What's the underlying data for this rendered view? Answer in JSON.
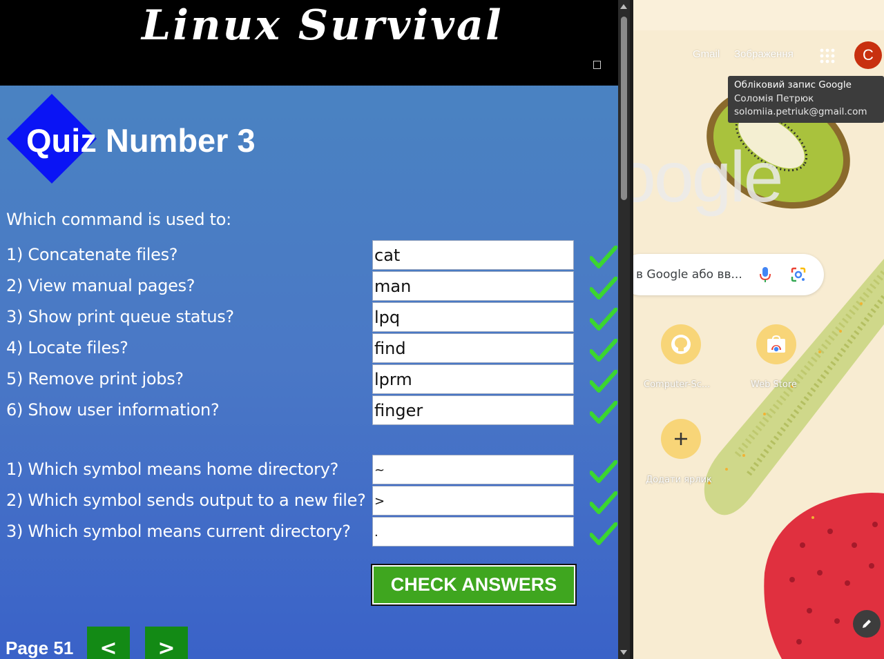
{
  "quiz_app": {
    "banner_title": "Linux Survival",
    "quiz_title": "Quiz Number 3",
    "intro": "Which command is used to:",
    "commands": [
      {
        "question": "1) Concatenate files?",
        "answer": "cat"
      },
      {
        "question": "2) View manual pages?",
        "answer": "man"
      },
      {
        "question": "3) Show print queue status?",
        "answer": "lpq"
      },
      {
        "question": "4) Locate files?",
        "answer": "find"
      },
      {
        "question": "5) Remove print jobs?",
        "answer": "lprm"
      },
      {
        "question": "6) Show user information?",
        "answer": "finger"
      }
    ],
    "symbols": [
      {
        "question": "1) Which symbol means home directory?",
        "answer": "~"
      },
      {
        "question": "2) Which symbol sends output to a new file?",
        "answer": ">"
      },
      {
        "question": "3) Which symbol means current directory?",
        "answer": "."
      }
    ],
    "check_button": "CHECK ANSWERS",
    "page_label": "Page 51",
    "prev_label": "<",
    "next_label": ">",
    "colors": {
      "check_green": "#3fa61f",
      "nav_green": "#138a15",
      "diamond": "#0a14f5"
    }
  },
  "browser": {
    "gmail": "Gmail",
    "images": "Зображення",
    "avatar_letter": "C",
    "tooltip": {
      "title": "Обліковий запис Google",
      "name": "Соломія Петрюк",
      "email": "solomiia.petriuk@gmail.com"
    },
    "logo": "oogle",
    "search_placeholder": "в Google або вв...",
    "shortcuts": [
      {
        "label": "Computer-Sc...",
        "icon": "github-icon"
      },
      {
        "label": "Web Store",
        "icon": "web-store-icon"
      },
      {
        "label": "Додати ярлик",
        "icon": "plus-icon"
      }
    ],
    "avatar_color": "#c8300f"
  }
}
